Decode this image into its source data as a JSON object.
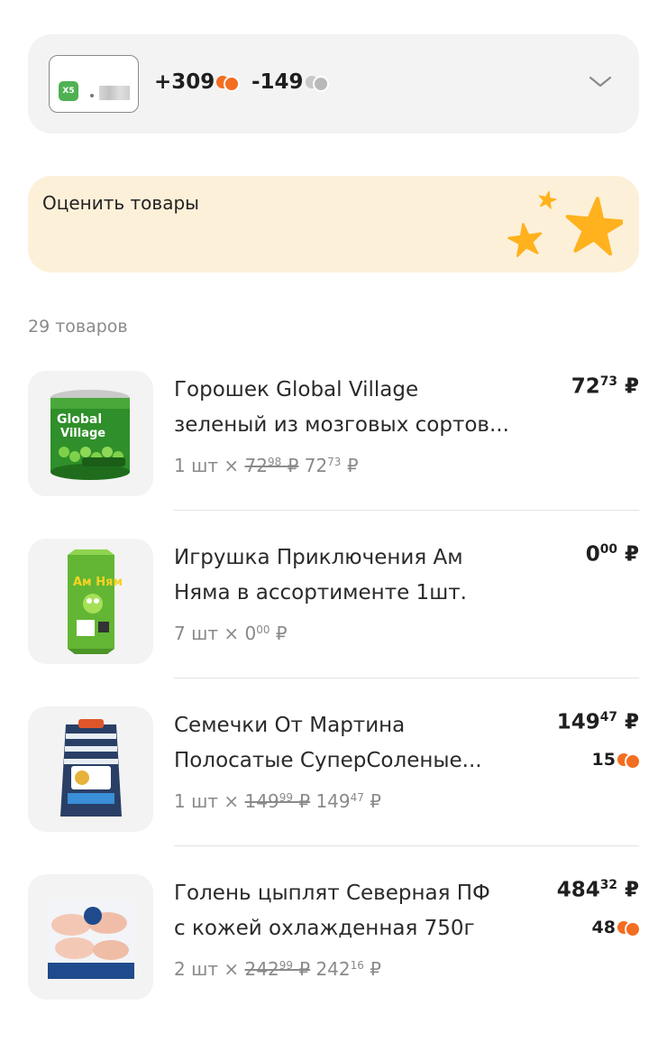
{
  "loyalty": {
    "card_logo": "X5",
    "card_number_masked": "•",
    "points_earned": "+309",
    "points_spent": "-149",
    "earned_coin_icon": "orange-coin-icon",
    "spent_coin_icon": "gray-coin-icon",
    "expand_icon": "chevron-down-icon"
  },
  "rate_banner": {
    "title": "Оценить товары",
    "icon": "stars-icon"
  },
  "items_count": "29 товаров",
  "products": [
    {
      "name": "Горошек Global Village\nзеленый из мозговых сортов...",
      "qty": "1 шт",
      "old_price_int": "72",
      "old_price_frac": "98",
      "unit_price_int": "72",
      "unit_price_frac": "73",
      "total_int": "72",
      "total_frac": "73",
      "bonus": "",
      "image_icon": "peas-can-image"
    },
    {
      "name": "Игрушка Приключения Ам\nНяма в ассортименте 1шт.",
      "qty": "7 шт",
      "old_price_int": "",
      "old_price_frac": "",
      "unit_price_int": "0",
      "unit_price_frac": "00",
      "total_int": "0",
      "total_frac": "00",
      "bonus": "",
      "image_icon": "toy-pack-image"
    },
    {
      "name": "Семечки От Мартина\nПолосатые СуперСоленые...",
      "qty": "1 шт",
      "old_price_int": "149",
      "old_price_frac": "99",
      "unit_price_int": "149",
      "unit_price_frac": "47",
      "total_int": "149",
      "total_frac": "47",
      "bonus": "15",
      "image_icon": "sunflower-seeds-bag-image"
    },
    {
      "name": "Голень цыплят Северная ПФ\nс кожей охлажденная 750г",
      "qty": "2 шт",
      "old_price_int": "242",
      "old_price_frac": "99",
      "unit_price_int": "242",
      "unit_price_frac": "16",
      "total_int": "484",
      "total_frac": "32",
      "bonus": "48",
      "image_icon": "chicken-pack-image"
    }
  ],
  "currency": "₽",
  "qty_separator": "×",
  "colors": {
    "accent_orange": "#f36e21",
    "star_yellow": "#ffb21e",
    "banner_bg": "#fdf0d9",
    "card_bg": "#f3f3f3",
    "x5_green": "#4fb152"
  }
}
